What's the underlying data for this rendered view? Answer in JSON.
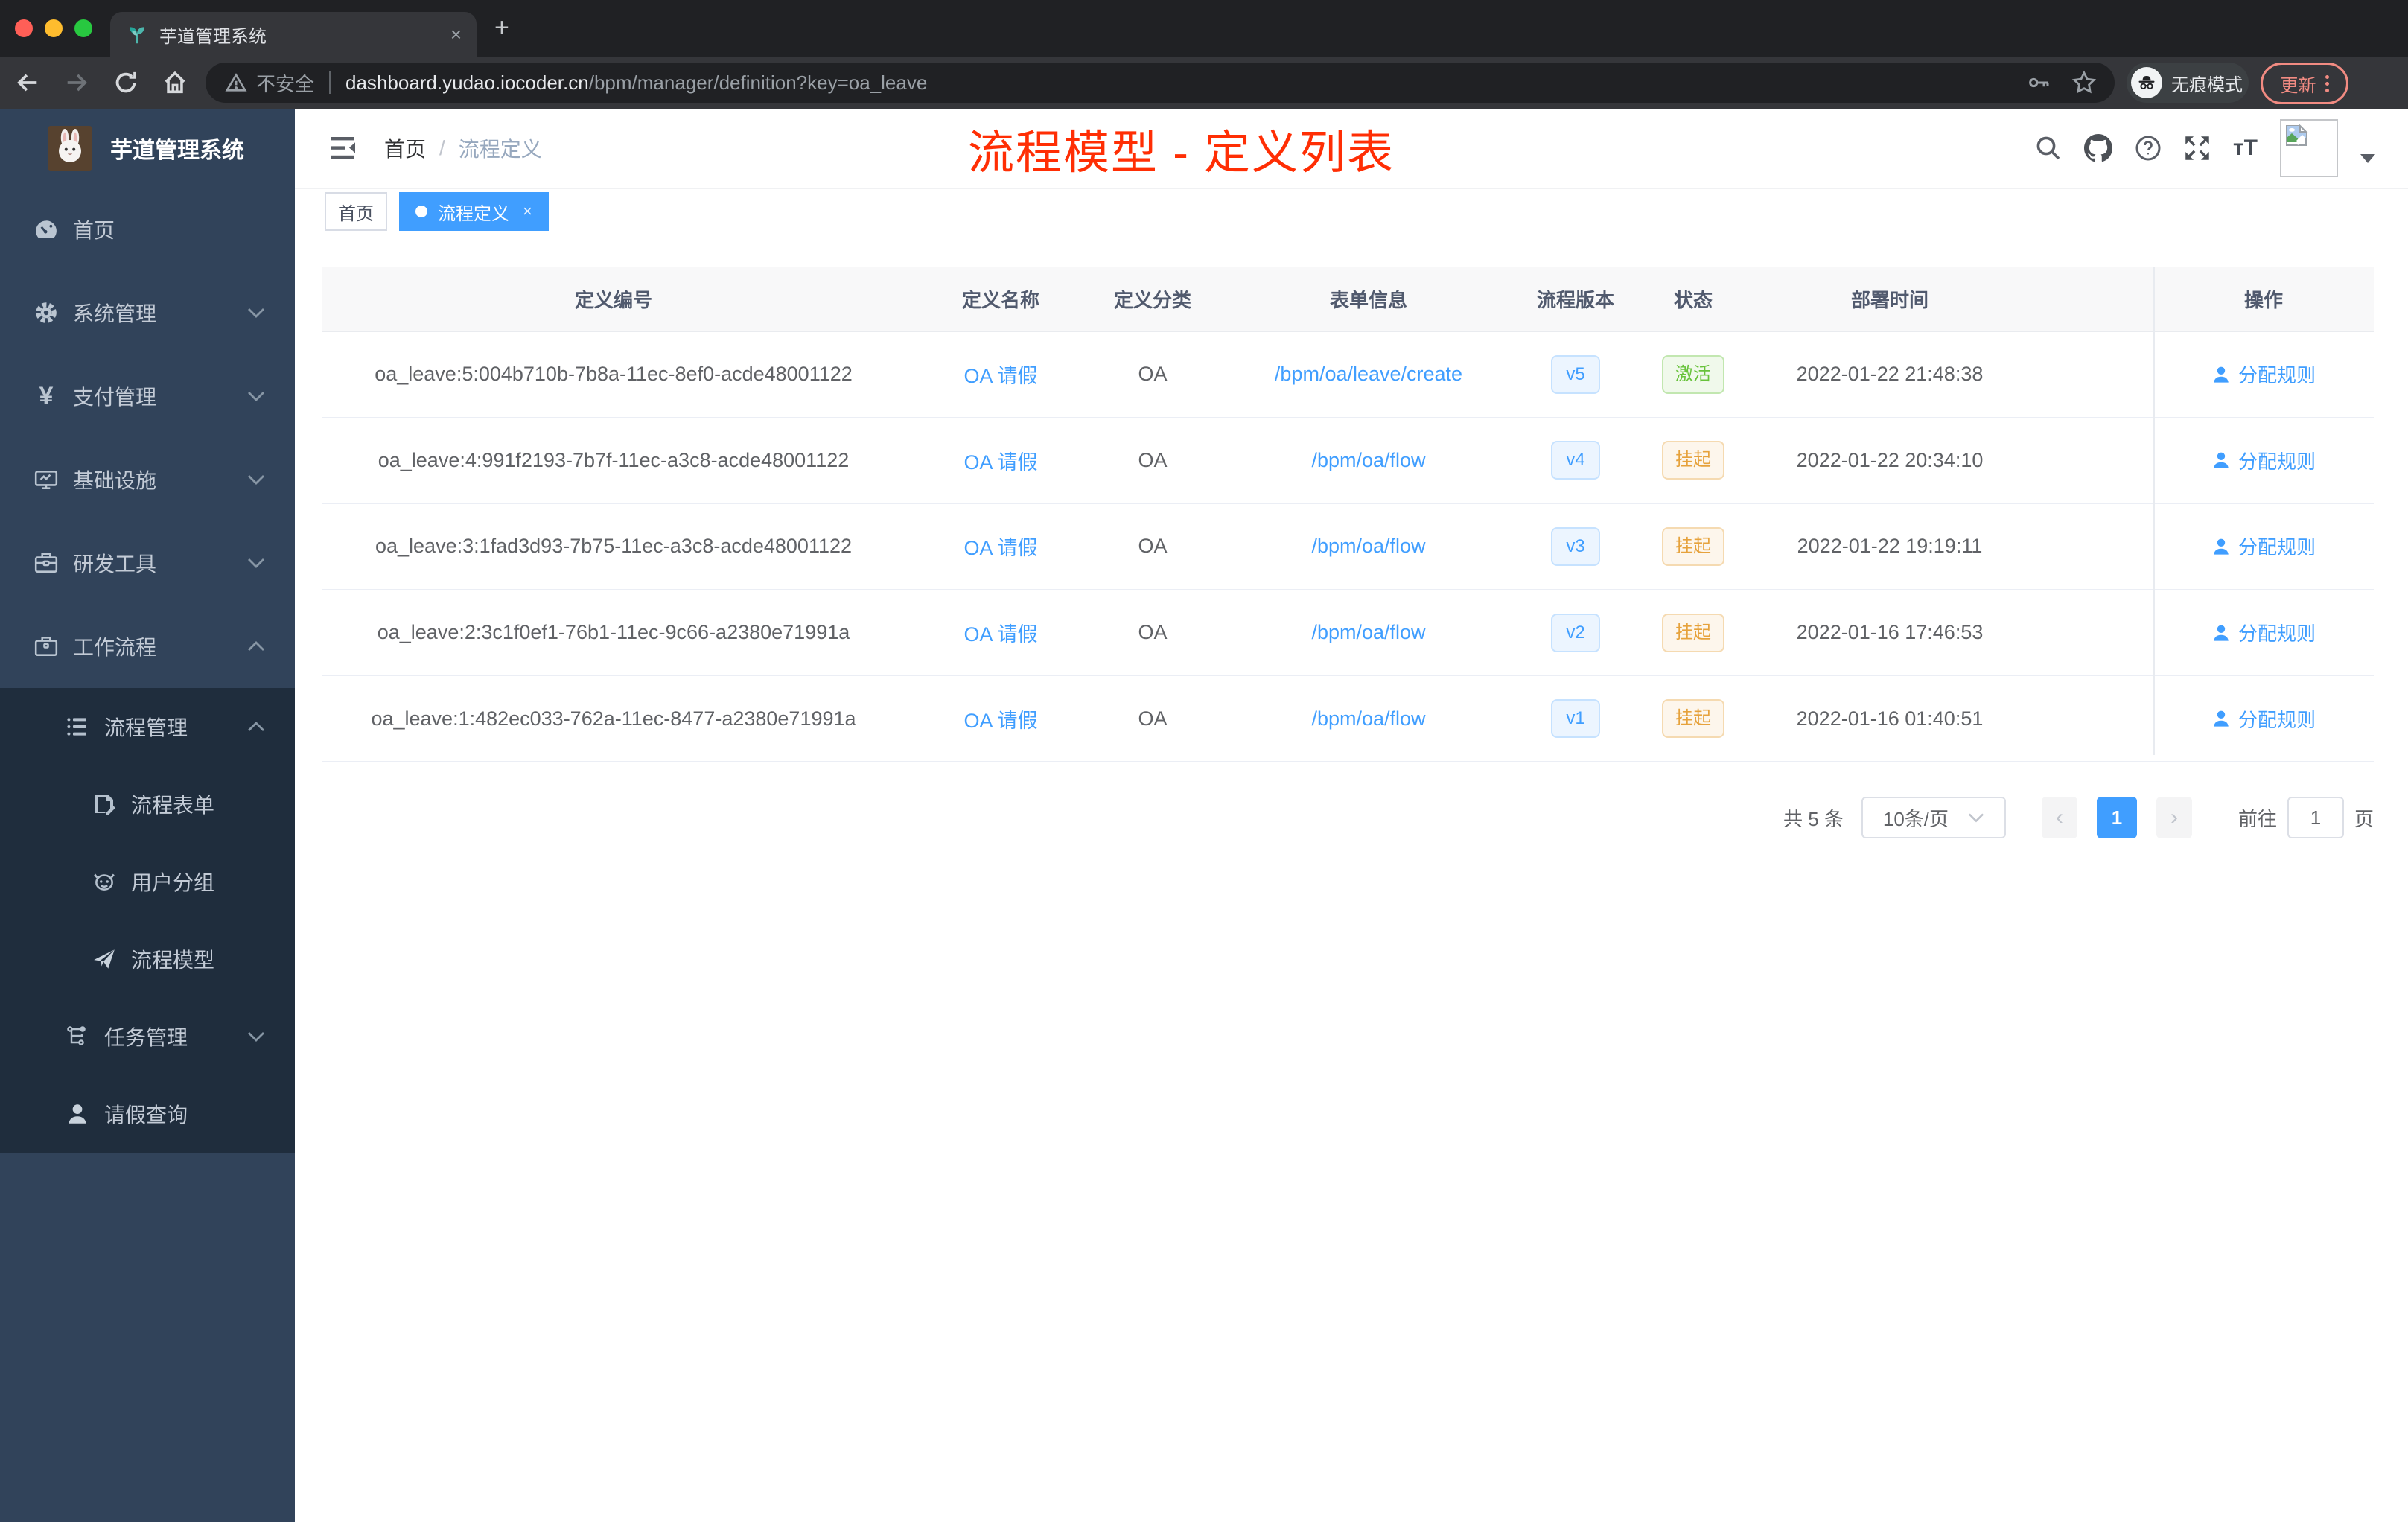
{
  "colors": {
    "accent": "#409eff",
    "success": "#67c23a",
    "warning": "#e6a23c",
    "annotation_red": "#ff2e04",
    "sidebar_bg": "#31435a",
    "submenu_bg": "#1f2d3d"
  },
  "browser": {
    "tab": {
      "title": "芋道管理系统",
      "close": "×",
      "new_tab": "+",
      "favicon": "plant-icon"
    },
    "address": {
      "warning": "不安全",
      "domain": "dashboard.yudao.iocoder.cn",
      "path": "/bpm/manager/definition?key=oa_leave"
    },
    "incognito_label": "无痕模式",
    "update_label": "更新"
  },
  "sidebar": {
    "logo_title": "芋道管理系统",
    "items": [
      {
        "label": "首页",
        "icon": "dashboard-icon"
      },
      {
        "label": "系统管理",
        "icon": "gear-icon",
        "chevron": "down"
      },
      {
        "label": "支付管理",
        "icon": "yen-icon",
        "chevron": "down"
      },
      {
        "label": "基础设施",
        "icon": "monitor-icon",
        "chevron": "down"
      },
      {
        "label": "研发工具",
        "icon": "toolbox-icon",
        "chevron": "down"
      },
      {
        "label": "工作流程",
        "icon": "briefcase-icon",
        "chevron": "up"
      },
      {
        "label": "流程管理",
        "icon": "list-icon",
        "chevron": "up"
      },
      {
        "label": "流程表单",
        "icon": "form-icon"
      },
      {
        "label": "用户分组",
        "icon": "group-icon"
      },
      {
        "label": "流程模型",
        "icon": "paper-plane-icon"
      },
      {
        "label": "任务管理",
        "icon": "tree-icon",
        "chevron": "down"
      },
      {
        "label": "请假查询",
        "icon": "person-icon"
      }
    ]
  },
  "header": {
    "breadcrumb": {
      "home": "首页",
      "separator": "/",
      "current": "流程定义"
    },
    "annotation": "流程模型 - 定义列表",
    "right_icons": [
      "search-icon",
      "github-icon",
      "help-icon",
      "fullscreen-icon",
      "font-size-icon",
      "avatar",
      "dropdown-caret"
    ]
  },
  "tags": {
    "home": {
      "label": "首页"
    },
    "active": {
      "label": "流程定义",
      "close": "×"
    }
  },
  "table": {
    "columns": [
      "定义编号",
      "定义名称",
      "定义分类",
      "表单信息",
      "流程版本",
      "状态",
      "部署时间",
      "操作"
    ],
    "action_label": "分配规则",
    "rows": [
      {
        "id": "oa_leave:5:004b710b-7b8a-11ec-8ef0-acde48001122",
        "name": "OA 请假",
        "category": "OA",
        "form": "/bpm/oa/leave/create",
        "version": "v5",
        "status": "激活",
        "status_type": "green",
        "time": "2022-01-22 21:48:38",
        "action": "分配规则"
      },
      {
        "id": "oa_leave:4:991f2193-7b7f-11ec-a3c8-acde48001122",
        "name": "OA 请假",
        "category": "OA",
        "form": "/bpm/oa/flow",
        "version": "v4",
        "status": "挂起",
        "status_type": "orange",
        "time": "2022-01-22 20:34:10",
        "action": "分配规则"
      },
      {
        "id": "oa_leave:3:1fad3d93-7b75-11ec-a3c8-acde48001122",
        "name": "OA 请假",
        "category": "OA",
        "form": "/bpm/oa/flow",
        "version": "v3",
        "status": "挂起",
        "status_type": "orange",
        "time": "2022-01-22 19:19:11",
        "action": "分配规则"
      },
      {
        "id": "oa_leave:2:3c1f0ef1-76b1-11ec-9c66-a2380e71991a",
        "name": "OA 请假",
        "category": "OA",
        "form": "/bpm/oa/flow",
        "version": "v2",
        "status": "挂起",
        "status_type": "orange",
        "time": "2022-01-16 17:46:53",
        "action": "分配规则"
      },
      {
        "id": "oa_leave:1:482ec033-762a-11ec-8477-a2380e71991a",
        "name": "OA 请假",
        "category": "OA",
        "form": "/bpm/oa/flow",
        "version": "v1",
        "status": "挂起",
        "status_type": "orange",
        "time": "2022-01-16 01:40:51",
        "action": "分配规则"
      }
    ]
  },
  "pagination": {
    "total": "共 5 条",
    "page_size": "10条/页",
    "prev": "‹",
    "page": "1",
    "next": "›",
    "goto_prefix": "前往",
    "goto_value": "1",
    "goto_suffix": "页"
  }
}
